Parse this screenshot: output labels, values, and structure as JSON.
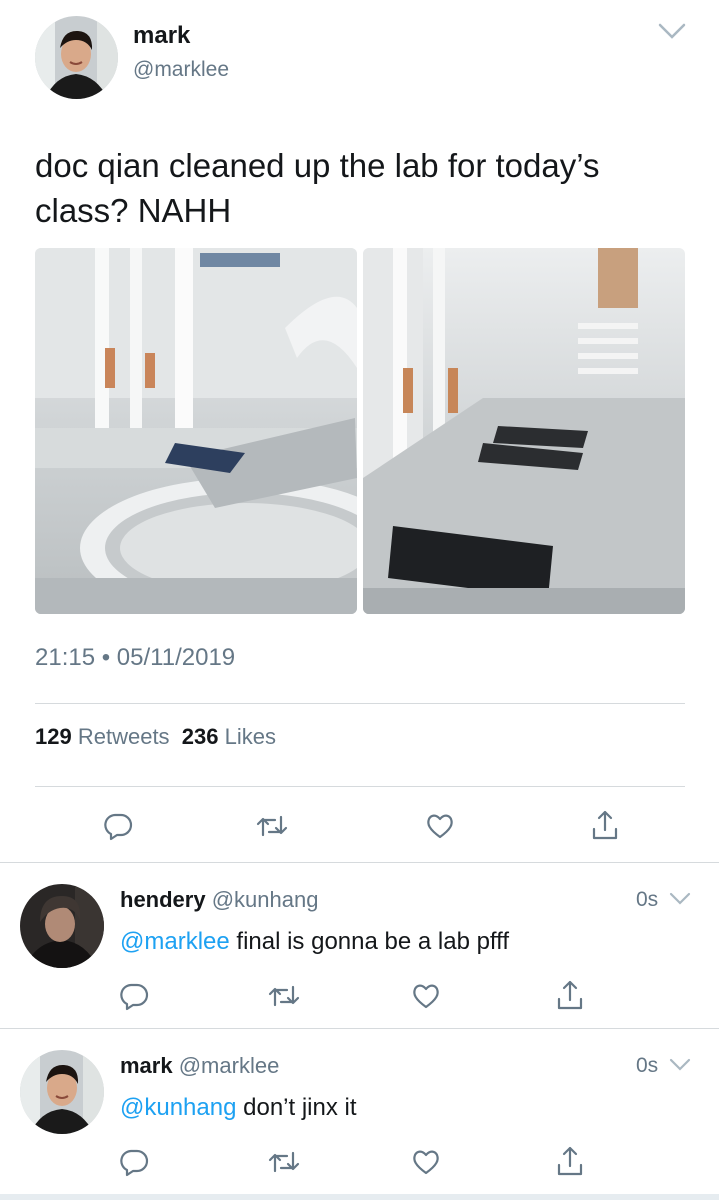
{
  "tweet": {
    "author_name": "mark",
    "author_handle": "@marklee",
    "text": "doc qian cleaned up the lab for today’s class? NAHH",
    "timestamp": "21:15 • 05/11/2019",
    "retweet_count": "129",
    "retweet_label": "Retweets",
    "like_count": "236",
    "like_label": "Likes",
    "media": [
      {
        "icon": "lab-photo-1"
      },
      {
        "icon": "lab-photo-2"
      }
    ]
  },
  "replies": [
    {
      "name": "hendery",
      "handle": "@kunhang",
      "time": "0s",
      "mention": "@marklee",
      "text": " final is gonna be a lab pfff"
    },
    {
      "name": "mark",
      "handle": "@marklee",
      "time": "0s",
      "mention": "@kunhang",
      "text": " don’t jinx it"
    }
  ],
  "icons": {
    "reply": "reply-icon",
    "retweet": "retweet-icon",
    "like": "heart-icon",
    "share": "share-icon",
    "menu": "chevron-down-icon"
  },
  "colors": {
    "text": "#14171a",
    "secondary": "#657786",
    "link": "#1da1f2",
    "divider": "#d6dadd"
  }
}
